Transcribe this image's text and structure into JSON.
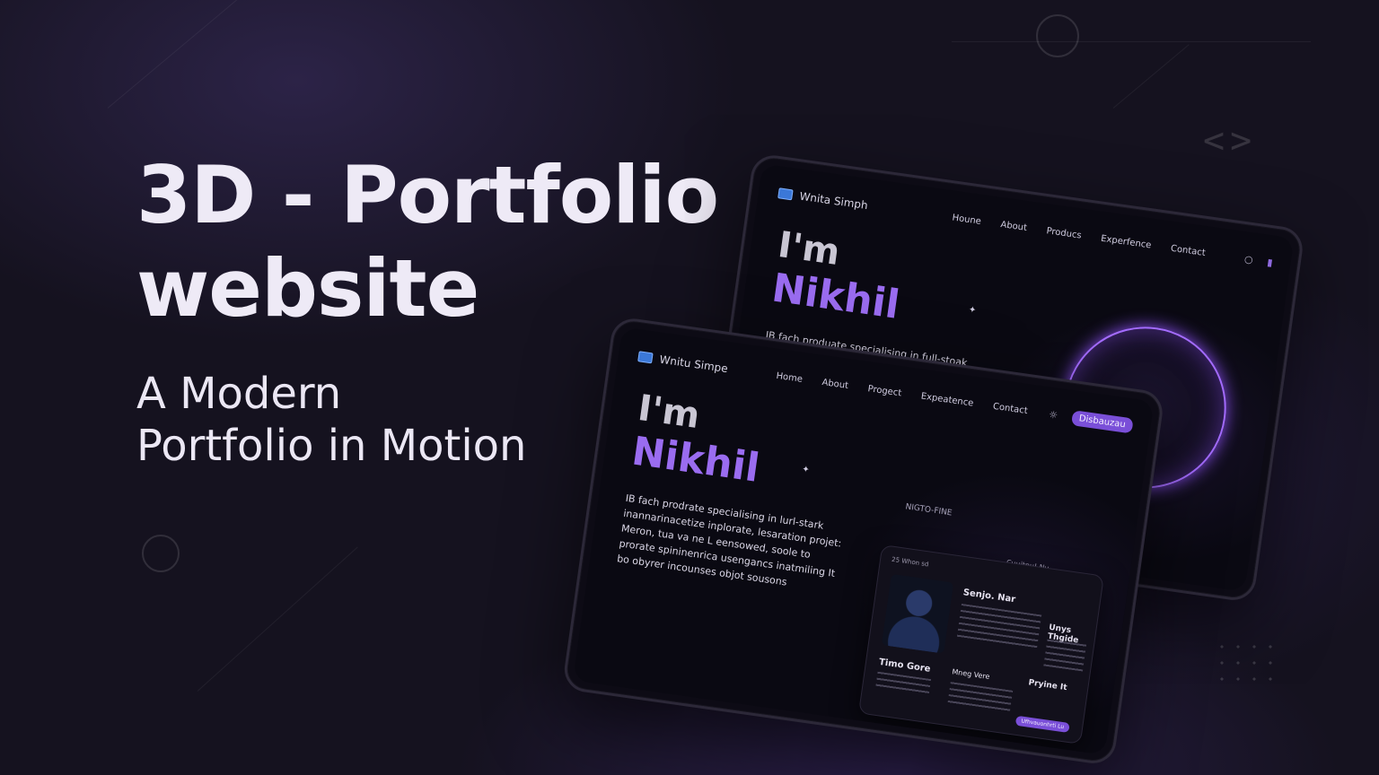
{
  "hero": {
    "title_line1": "3D - Portfolio",
    "title_line2": "website",
    "subtitle_line1": "A Modern",
    "subtitle_line2": "Portfolio in Motion"
  },
  "back_device": {
    "logo": "Wnita Simph",
    "nav": [
      "Houne",
      "About",
      "Producs",
      "Experfence",
      "Contact"
    ],
    "greeting": "I'm",
    "name": "Nikhil",
    "description": "IB fach produate specialising in full-stoak sronnagement with orgiortole. It doenbergn"
  },
  "front_device": {
    "logo": "Wnitu Simpe",
    "nav": [
      "Home",
      "About",
      "Progect",
      "Expeatence",
      "Contact"
    ],
    "button": "Disbauzau",
    "greeting": "I'm",
    "name": "Nikhil",
    "description": "IB fach prodrate specialising in lurl-stark inannarinacetize inplorate, lesaration projet: Meron, tua va ne L eensowed, soole to prorate spininenrica usengancs inatmiling It bo obyrer incounses objot sousons",
    "card": {
      "sub": "25 Whon sd",
      "heading1": "Senjo. Nar",
      "heading2": "Timo Gore",
      "heading3": "Unys Thgide",
      "heading4": "Pryine It",
      "heading5": "Mneg Vere",
      "button": "Ufhvauonhrti Lu"
    },
    "panel_heading": "NIGTO-FINE",
    "panel_heading2": "Cuuitnu! Nv"
  }
}
